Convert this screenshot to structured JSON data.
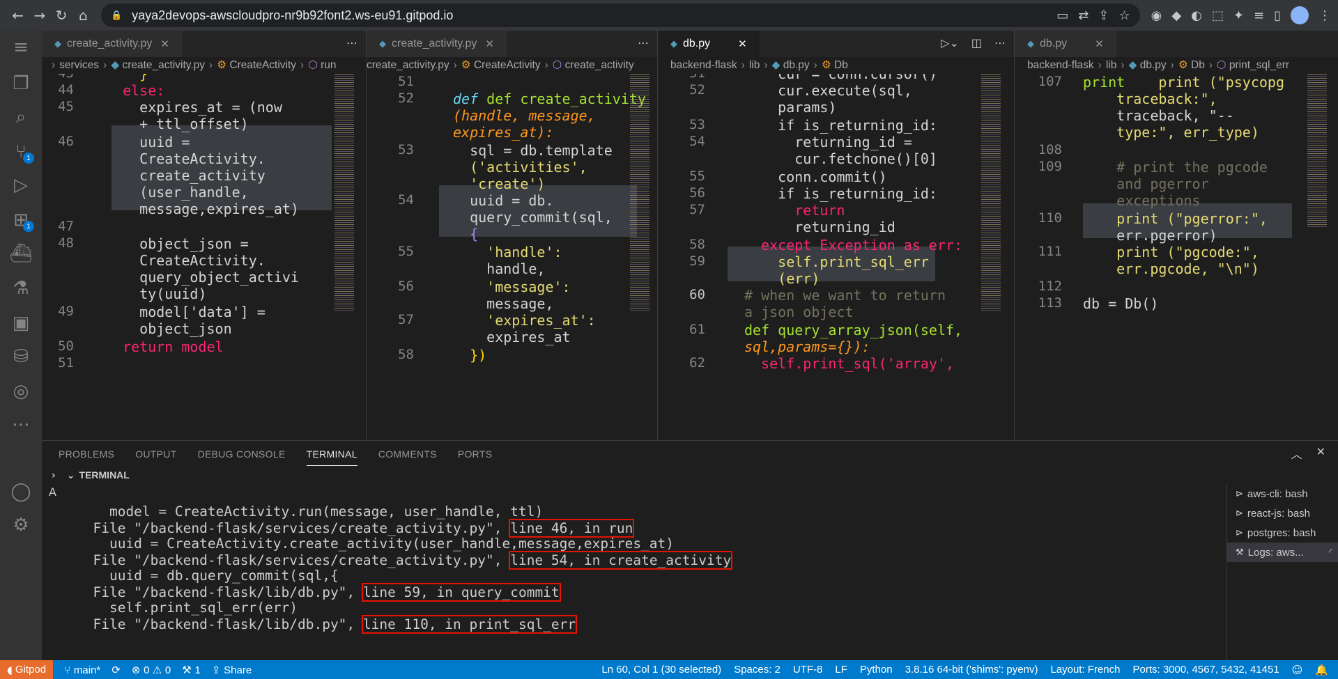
{
  "browser": {
    "url": "yaya2devops-awscloudpro-nr9b92font2.ws-eu91.gitpod.io",
    "icons": [
      "back-icon",
      "forward-icon",
      "reload-icon",
      "home-icon"
    ]
  },
  "editors": [
    {
      "tab": "create_activity.py",
      "crumbs": [
        "services",
        "create_activity.py",
        "CreateActivity",
        "run"
      ],
      "lines": [
        "43",
        "44",
        "45",
        "46",
        "47",
        "48",
        "49",
        "50",
        "51"
      ],
      "code": [
        "    }",
        "  else:",
        "    expires_at = (now",
        "    + ttl_offset)",
        "    uuid =",
        "    CreateActivity.",
        "    create_activity",
        "    (user_handle,",
        "    message,expires_at)",
        "",
        "    object_json =",
        "    CreateActivity.",
        "    query_object_activi",
        "    ty(uuid)",
        "    model['data'] =",
        "    object_json",
        "  return model"
      ]
    },
    {
      "tab": "create_activity.py",
      "crumbs": [
        "create_activity.py",
        "CreateActivity",
        "create_activity"
      ],
      "lines": [
        "51",
        "52",
        "53",
        "54",
        "55",
        "56",
        "57",
        "58"
      ],
      "code": [
        "",
        "def create_activity",
        "(handle, message,",
        "expires_at):",
        "  sql = db.template",
        "  ('activities',",
        "  'create')",
        "  uuid = db.",
        "  query_commit(sql,",
        "  {",
        "    'handle':",
        "    handle,",
        "    'message':",
        "    message,",
        "    'expires_at':",
        "    expires_at",
        "  })"
      ]
    },
    {
      "tab": "db.py",
      "crumbs": [
        "backend-flask",
        "lib",
        "db.py",
        "Db"
      ],
      "lines": [
        "51",
        "52",
        "53",
        "54",
        "55",
        "56",
        "57",
        "58",
        "59",
        "60",
        "61",
        "62"
      ],
      "code": [
        "    cur = conn.cursor()",
        "    cur.execute(sql,",
        "    params)",
        "    if is_returning_id:",
        "      returning_id =",
        "      cur.fetchone()[0]",
        "    conn.commit()",
        "    if is_returning_id:",
        "      return",
        "      returning_id",
        "  except Exception as err:",
        "    self.print_sql_err",
        "    (err)",
        "# when we want to return",
        "a json object",
        "def query_array_json(self,",
        "sql,params={}):",
        "  self.print_sql('array',"
      ]
    },
    {
      "tab": "db.py",
      "crumbs": [
        "backend-flask",
        "lib",
        "db.py",
        "Db",
        "print_sql_err"
      ],
      "lines": [
        "107",
        "108",
        "109",
        "110",
        "111",
        "112",
        "113"
      ],
      "code": [
        "    print (\"psycopg",
        "    traceback:\",",
        "    traceback, \"--",
        "    type:\", err_type)",
        "",
        "    # print the pgcode",
        "    and pgerror",
        "    exceptions",
        "    print (\"pgerror:\",",
        "    err.pgerror)",
        "    print (\"pgcode:\",",
        "    err.pgcode, \"\\n\")",
        "",
        "db = Db()"
      ]
    }
  ],
  "panel": {
    "tabs": [
      "PROBLEMS",
      "OUTPUT",
      "DEBUG CONSOLE",
      "TERMINAL",
      "COMMENTS",
      "PORTS"
    ],
    "active_tab": "TERMINAL",
    "section": "TERMINAL",
    "terminal": [
      "    model = CreateActivity.run(message, user_handle, ttl)",
      "  File \"/backend-flask/services/create_activity.py\", ",
      "    uuid = CreateActivity.create_activity(user_handle,message,expires_at)",
      "  File \"/backend-flask/services/create_activity.py\", ",
      "    uuid = db.query_commit(sql,{",
      "  File \"/backend-flask/lib/db.py\", ",
      "    self.print_sql_err(err)",
      "  File \"/backend-flask/lib/db.py\", "
    ],
    "highlights": [
      "line 46, in run",
      "line 54, in create_activity",
      "line 59, in query_commit",
      "line 110, in print_sql_err"
    ],
    "terminals": [
      "aws-cli: bash",
      "react-js: bash",
      "postgres: bash",
      "Logs: aws..."
    ]
  },
  "status": {
    "gitpod": "Gitpod",
    "branch": "main*",
    "problems": "0",
    "warnings": "0",
    "ports_count": "1",
    "share": "Share",
    "position": "Ln 60, Col 1 (30 selected)",
    "spaces": "Spaces: 2",
    "encoding": "UTF-8",
    "eol": "LF",
    "language": "Python",
    "interpreter": "3.8.16 64-bit ('shims': pyenv)",
    "layout": "Layout: French",
    "ports": "Ports: 3000, 4567, 5432, 41451"
  },
  "colors": {
    "statusbar": "#007acc",
    "gitpod": "#e86c2c",
    "highlight": "#e51400"
  }
}
